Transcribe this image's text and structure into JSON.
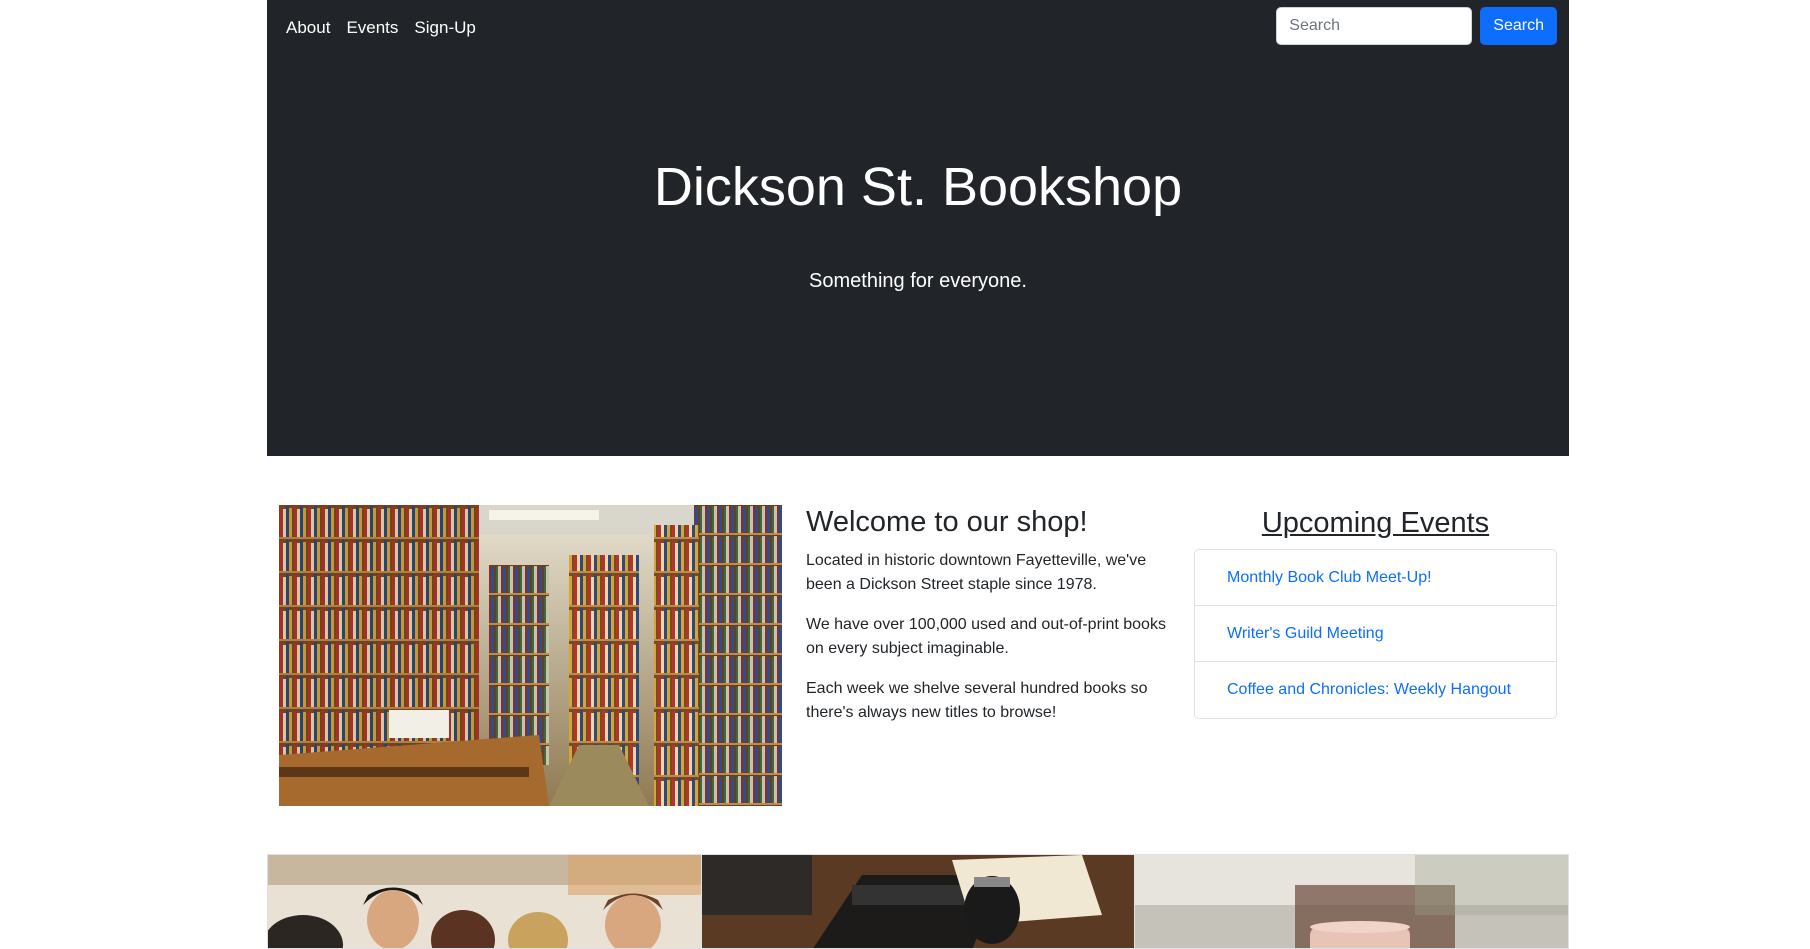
{
  "nav": {
    "items": [
      {
        "label": "About"
      },
      {
        "label": "Events"
      },
      {
        "label": "Sign-Up"
      }
    ]
  },
  "search": {
    "placeholder": "Search",
    "value": "",
    "button_label": "Search"
  },
  "hero": {
    "title": "Dickson St. Bookshop",
    "subtitle": "Something for everyone."
  },
  "welcome": {
    "heading": "Welcome to our shop!",
    "paragraphs": [
      "Located in historic downtown Fayetteville, we've been a Dickson Street staple since 1978.",
      "We have over 100,000 used and out-of-print books on every subject imaginable.",
      "Each week we shelve several hundred books so there's always new titles to browse!"
    ]
  },
  "events": {
    "heading": "Upcoming Events",
    "items": [
      {
        "label": "Monthly Book Club Meet-Up!"
      },
      {
        "label": "Writer's Guild Meeting"
      },
      {
        "label": "Coffee and Chronicles: Weekly Hangout"
      }
    ]
  },
  "images": {
    "shop_interior": "bookshop-interior-photo",
    "gallery": [
      "students-reading-photo",
      "typewriter-and-coffee-photo",
      "coffee-cup-photo"
    ]
  },
  "colors": {
    "hero_bg": "#212529",
    "primary": "#0d6efd",
    "link": "#0d6efd",
    "border": "#dee2e6"
  }
}
